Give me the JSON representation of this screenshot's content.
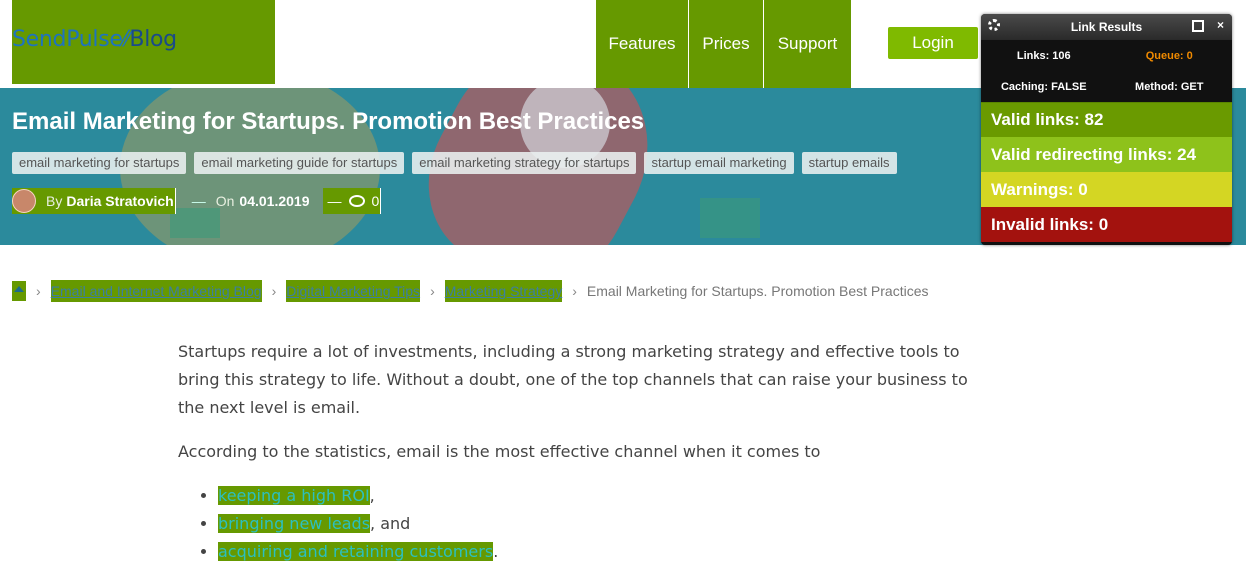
{
  "header": {
    "logo_left": "SendPulse",
    "logo_right": "Blog",
    "nav": [
      "Features",
      "Prices",
      "Support"
    ],
    "login": "Login"
  },
  "hero": {
    "title": "Email Marketing for Startups. Promotion Best Practices",
    "tags": [
      "email marketing for startups",
      "email marketing guide for startups",
      "email marketing strategy for startups",
      "startup email marketing",
      "startup emails"
    ],
    "by_label": "By",
    "author": "Daria Stratovich",
    "dash": "—",
    "on_label": "On",
    "date": "04.01.2019",
    "comments_count": "0"
  },
  "breadcrumb": {
    "home_icon": "home-icon",
    "chevron": "›",
    "links": [
      "Email and Internet Marketing Blog",
      "Digital Marketing Tips",
      "Marketing Strategy"
    ],
    "current": "Email Marketing for Startups. Promotion Best Practices"
  },
  "article": {
    "p1": "Startups require a lot of investments, including a strong marketing strategy and effective tools to bring this strategy to life. Without a doubt, one of the top channels that can raise your business to the next level is email.",
    "p2": "According to the statistics, email is the most effective channel when it comes to",
    "list": [
      {
        "link": "keeping a high ROI",
        "after": ","
      },
      {
        "link": "bringing new leads",
        "after": ", and"
      },
      {
        "link": "acquiring and retaining customers",
        "after": "."
      }
    ]
  },
  "link_results": {
    "title": "Link Results",
    "close": "×",
    "links": "Links: 106",
    "queue": "Queue: 0",
    "caching": "Caching: FALSE",
    "method": "Method: GET",
    "valid": "Valid links: 82",
    "redirecting": "Valid redirecting links: 24",
    "warnings": "Warnings: 0",
    "invalid": "Invalid links: 0"
  },
  "colors": {
    "highlight": "#669900",
    "hero": "#2b8a9c",
    "login": "#7fba00",
    "invalid": "#a3120e"
  }
}
